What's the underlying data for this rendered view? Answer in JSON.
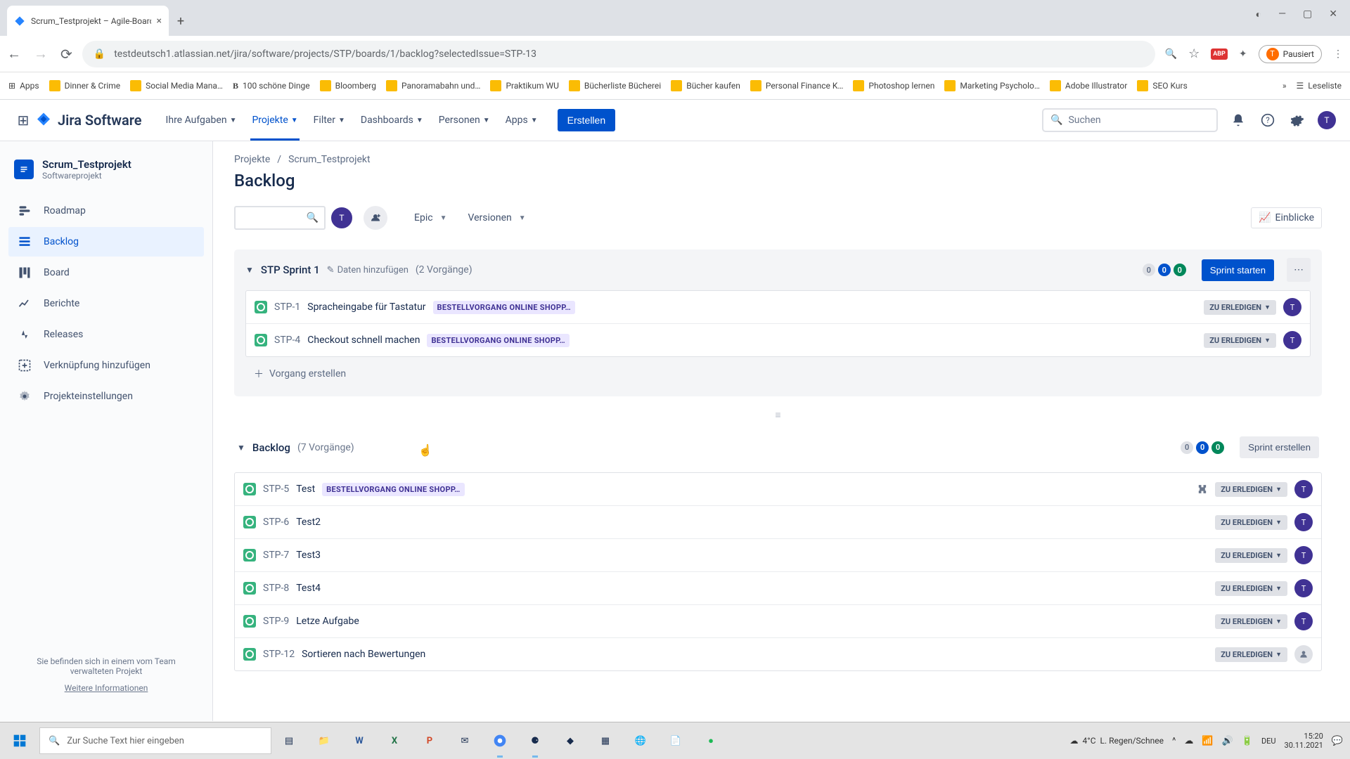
{
  "browser": {
    "tab_title": "Scrum_Testprojekt – Agile-Board",
    "url": "testdeutsch1.atlassian.net/jira/software/projects/STP/boards/1/backlog?selectedIssue=STP-13",
    "profile_status": "Pausiert",
    "bookmarks": [
      "Apps",
      "Dinner & Crime",
      "Social Media Mana…",
      "100 schöne Dinge",
      "Bloomberg",
      "Panoramabahn und…",
      "Praktikum WU",
      "Bücherliste Bücherei",
      "Bücher kaufen",
      "Personal Finance K…",
      "Photoshop lernen",
      "Marketing Psycholo…",
      "Adobe Illustrator",
      "SEO Kurs"
    ],
    "reading_list": "Leseliste"
  },
  "jira_header": {
    "product": "Jira Software",
    "nav": [
      "Ihre Aufgaben",
      "Projekte",
      "Filter",
      "Dashboards",
      "Personen",
      "Apps"
    ],
    "active_nav_index": 1,
    "create": "Erstellen",
    "search_placeholder": "Suchen",
    "avatar_initial": "T"
  },
  "sidebar": {
    "project_name": "Scrum_Testprojekt",
    "project_type": "Softwareprojekt",
    "items": [
      {
        "label": "Roadmap",
        "icon": "roadmap"
      },
      {
        "label": "Backlog",
        "icon": "backlog"
      },
      {
        "label": "Board",
        "icon": "board"
      },
      {
        "label": "Berichte",
        "icon": "reports"
      },
      {
        "label": "Releases",
        "icon": "releases"
      },
      {
        "label": "Verknüpfung hinzufügen",
        "icon": "link"
      },
      {
        "label": "Projekteinstellungen",
        "icon": "settings"
      }
    ],
    "active_index": 1,
    "footer_text": "Sie befinden sich in einem vom Team verwalteten Projekt",
    "footer_link": "Weitere Informationen"
  },
  "breadcrumb": {
    "root": "Projekte",
    "project": "Scrum_Testprojekt"
  },
  "page_title": "Backlog",
  "filters": {
    "avatar_initial": "T",
    "epic": "Epic",
    "versions": "Versionen",
    "insights": "Einblicke"
  },
  "sprint": {
    "name": "STP Sprint 1",
    "add_dates": "Daten hinzufügen",
    "count_label": "(2 Vorgänge)",
    "pills": [
      "0",
      "0",
      "0"
    ],
    "start_btn": "Sprint starten",
    "issues": [
      {
        "key": "STP-1",
        "summary": "Spracheingabe für Tastatur",
        "epic": "BESTELLVORGANG ONLINE SHOPP…",
        "status": "ZU ERLEDIGEN",
        "assignee": "T"
      },
      {
        "key": "STP-4",
        "summary": "Checkout schnell machen",
        "epic": "BESTELLVORGANG ONLINE SHOPP…",
        "status": "ZU ERLEDIGEN",
        "assignee": "T"
      }
    ],
    "create_issue": "Vorgang erstellen"
  },
  "backlog": {
    "name": "Backlog",
    "count_label": "(7 Vorgänge)",
    "pills": [
      "0",
      "0",
      "0"
    ],
    "create_btn": "Sprint erstellen",
    "issues": [
      {
        "key": "STP-5",
        "summary": "Test",
        "epic": "BESTELLVORGANG ONLINE SHOPP…",
        "status": "ZU ERLEDIGEN",
        "assignee": "T",
        "has_child": true
      },
      {
        "key": "STP-6",
        "summary": "Test2",
        "epic": null,
        "status": "ZU ERLEDIGEN",
        "assignee": "T"
      },
      {
        "key": "STP-7",
        "summary": "Test3",
        "epic": null,
        "status": "ZU ERLEDIGEN",
        "assignee": "T"
      },
      {
        "key": "STP-8",
        "summary": "Test4",
        "epic": null,
        "status": "ZU ERLEDIGEN",
        "assignee": "T"
      },
      {
        "key": "STP-9",
        "summary": "Letze Aufgabe",
        "epic": null,
        "status": "ZU ERLEDIGEN",
        "assignee": "T"
      },
      {
        "key": "STP-12",
        "summary": "Sortieren nach Bewertungen",
        "epic": null,
        "status": "ZU ERLEDIGEN",
        "assignee": null
      }
    ]
  },
  "taskbar": {
    "search_ph": "Zur Suche Text hier eingeben",
    "weather_temp": "4°C",
    "weather_text": "L. Regen/Schnee",
    "time": "15:20",
    "date": "30.11.2021",
    "lang": "DEU"
  }
}
